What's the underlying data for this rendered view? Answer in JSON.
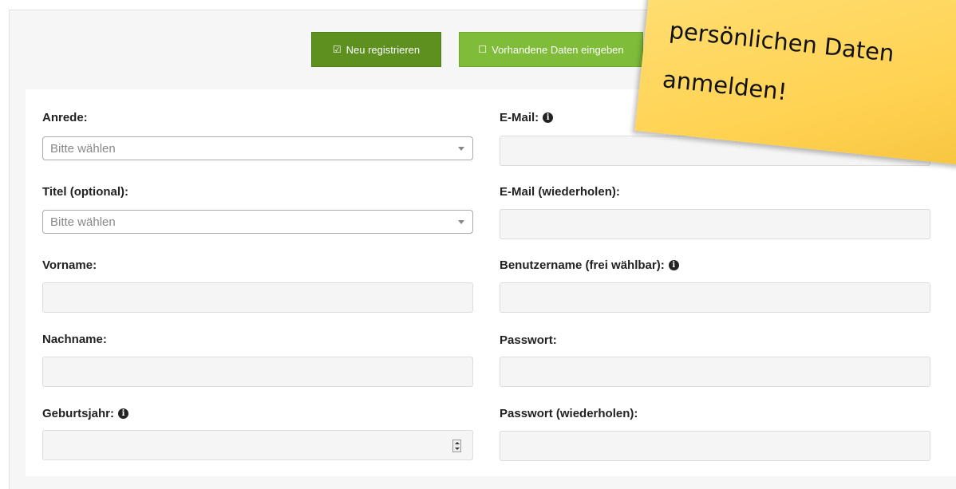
{
  "buttons": {
    "new_label": "Neu registrieren",
    "existing_label": "Vorhandene Daten eingeben"
  },
  "sticky_note": {
    "line1": "persönlichen Daten",
    "line2": "anmelden!"
  },
  "form": {
    "left": {
      "anrede_label": "Anrede:",
      "anrede_placeholder": "Bitte wählen",
      "titel_label": "Titel (optional):",
      "titel_placeholder": "Bitte wählen",
      "vorname_label": "Vorname:",
      "nachname_label": "Nachname:",
      "geburtsjahr_label": "Geburtsjahr:"
    },
    "right": {
      "email_label": "E-Mail:",
      "email_repeat_label": "E-Mail (wiederholen):",
      "username_label": "Benutzername (frei wählbar):",
      "password_label": "Passwort:",
      "password_repeat_label": "Passwort (wiederholen):"
    }
  },
  "colors": {
    "primary_button": "#5e9020",
    "secondary_button": "#7fbc3a",
    "sticky_note": "#ffd252"
  },
  "icons": [
    "checkbox-checked-icon",
    "checkbox-empty-icon",
    "info-icon",
    "chevron-down-icon",
    "spinner-icon"
  ]
}
